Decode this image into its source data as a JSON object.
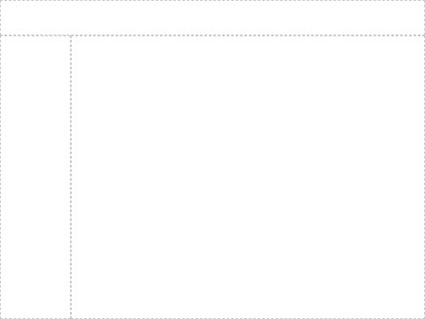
{
  "topbar": {
    "text": ""
  },
  "sidebar": {
    "text": ""
  },
  "main": {
    "text": ""
  }
}
